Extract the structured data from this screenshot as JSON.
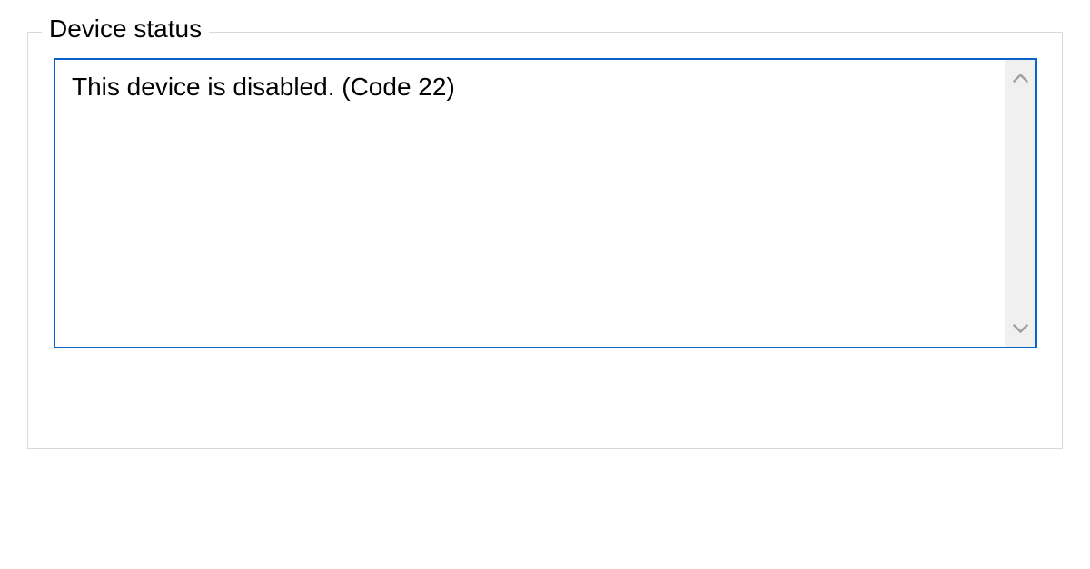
{
  "device_status": {
    "legend": "Device status",
    "message": "This device is disabled. (Code 22)"
  }
}
